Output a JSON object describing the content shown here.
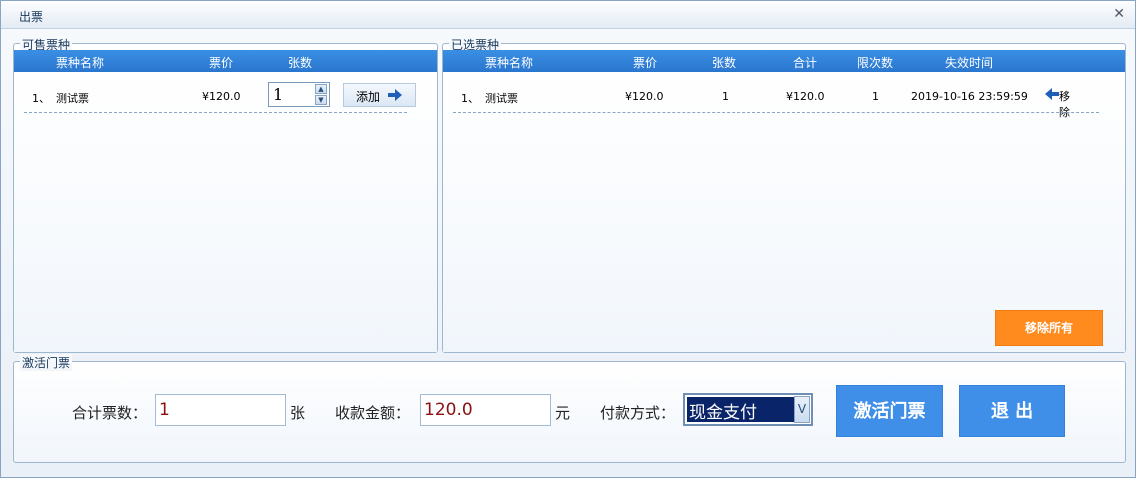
{
  "window": {
    "title": "出票",
    "close_icon": "close-icon"
  },
  "available": {
    "legend": "可售票种",
    "headers": [
      "票种名称",
      "票价",
      "张数"
    ],
    "rows": [
      {
        "index": "1、",
        "name": "测试票",
        "price": "¥120.0",
        "qty": "1",
        "add_label": "添加"
      }
    ]
  },
  "selected": {
    "legend": "已选票种",
    "headers": [
      "票种名称",
      "票价",
      "张数",
      "合计",
      "限次数",
      "失效时间"
    ],
    "rows": [
      {
        "index": "1、",
        "name": "测试票",
        "price": "¥120.0",
        "qty": "1",
        "total": "¥120.0",
        "limit": "1",
        "expire": "2019-10-16 23:59:59",
        "remove_label": "移除"
      }
    ],
    "remove_all_label": "移除所有"
  },
  "activate": {
    "legend": "激活门票",
    "total_tickets_label": "合计票数：",
    "total_tickets_value": "1",
    "total_tickets_unit": "张",
    "amount_label": "收款金额：",
    "amount_value": "120.0",
    "amount_unit": "元",
    "payment_label": "付款方式：",
    "payment_value": "现金支付",
    "activate_button": "激活门票",
    "exit_button": "退 出"
  },
  "colors": {
    "header_blue": "#2a76cf",
    "orange": "#ff8a1e",
    "button_blue": "#3f8ee8",
    "amount_text": "#8b1010"
  }
}
